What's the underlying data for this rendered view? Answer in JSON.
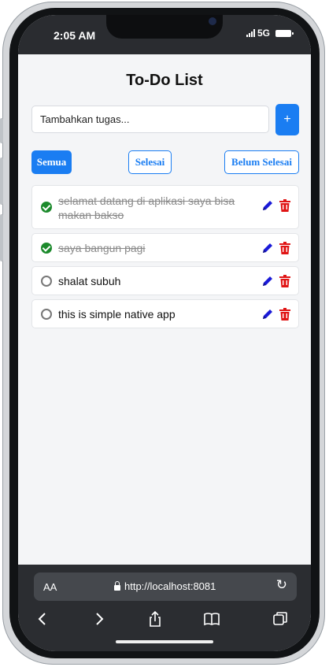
{
  "status": {
    "time": "2:05 AM",
    "network": "5G"
  },
  "app": {
    "title": "To-Do List",
    "input": {
      "placeholder": "Tambahkan tugas...",
      "value": ""
    },
    "add_label": "+",
    "filters": {
      "all": "Semua",
      "done": "Selesai",
      "undone": "Belum Selesai",
      "active": "all"
    },
    "tasks": [
      {
        "text": "selamat datang di aplikasi saya bisa makan bakso",
        "completed": true
      },
      {
        "text": "saya bangun pagi",
        "completed": true
      },
      {
        "text": "shalat subuh",
        "completed": false
      },
      {
        "text": "this is simple native app",
        "completed": false
      }
    ]
  },
  "browser": {
    "text_size_label": "AA",
    "url": "http://localhost:8081"
  },
  "colors": {
    "primary": "#1a7df2",
    "done_check": "#1c8a2c",
    "delete": "#e01515",
    "edit": "#1a1ad8"
  }
}
